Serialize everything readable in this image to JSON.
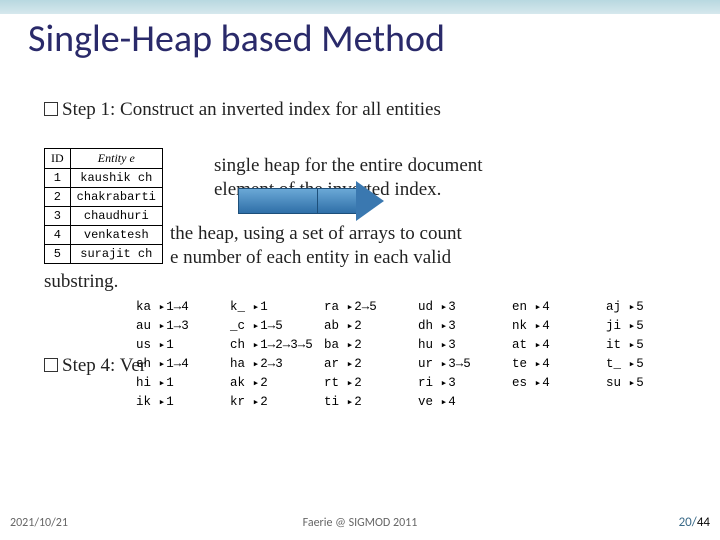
{
  "title": "Single-Heap based Method",
  "steps": {
    "s1": "Step 1: Construct an inverted index for all entities",
    "s2_a": "single heap for the entire document",
    "s2_b": "element of the inverted index.",
    "s3_a": "the heap, using a set of arrays to count",
    "s3_b": "e number of each entity in each valid",
    "s3_c": "substring.",
    "s4": "Step 4: Ver"
  },
  "entity_table": {
    "headers": {
      "id": "ID",
      "entity": "Entity e"
    },
    "rows": [
      {
        "id": "1",
        "entity": "kaushik ch"
      },
      {
        "id": "2",
        "entity": "chakrabarti"
      },
      {
        "id": "3",
        "entity": "chaudhuri"
      },
      {
        "id": "4",
        "entity": "venkatesh"
      },
      {
        "id": "5",
        "entity": "surajit ch"
      }
    ]
  },
  "inverted_index": [
    [
      {
        "tok": "ka",
        "list": "1→4"
      },
      {
        "tok": "k_",
        "list": "1"
      },
      {
        "tok": "ra",
        "list": "2→5"
      },
      {
        "tok": "ud",
        "list": "3"
      },
      {
        "tok": "en",
        "list": "4"
      },
      {
        "tok": "aj",
        "list": "5"
      }
    ],
    [
      {
        "tok": "au",
        "list": "1→3"
      },
      {
        "tok": "_c",
        "list": "1→5"
      },
      {
        "tok": "ab",
        "list": "2"
      },
      {
        "tok": "dh",
        "list": "3"
      },
      {
        "tok": "nk",
        "list": "4"
      },
      {
        "tok": "ji",
        "list": "5"
      }
    ],
    [
      {
        "tok": "us",
        "list": "1"
      },
      {
        "tok": "ch",
        "list": "1→2→3→5"
      },
      {
        "tok": "ba",
        "list": "2"
      },
      {
        "tok": "hu",
        "list": "3"
      },
      {
        "tok": "at",
        "list": "4"
      },
      {
        "tok": "it",
        "list": "5"
      }
    ],
    [
      {
        "tok": "sh",
        "list": "1→4"
      },
      {
        "tok": "ha",
        "list": "2→3"
      },
      {
        "tok": "ar",
        "list": "2"
      },
      {
        "tok": "ur",
        "list": "3→5"
      },
      {
        "tok": "te",
        "list": "4"
      },
      {
        "tok": "t_",
        "list": "5"
      }
    ],
    [
      {
        "tok": "hi",
        "list": "1"
      },
      {
        "tok": "ak",
        "list": "2"
      },
      {
        "tok": "rt",
        "list": "2"
      },
      {
        "tok": "ri",
        "list": "3"
      },
      {
        "tok": "es",
        "list": "4"
      },
      {
        "tok": "su",
        "list": "5"
      }
    ],
    [
      {
        "tok": "ik",
        "list": "1"
      },
      {
        "tok": "kr",
        "list": "2"
      },
      {
        "tok": "ti",
        "list": "2"
      },
      {
        "tok": "ve",
        "list": "4"
      },
      {
        "tok": "",
        "list": ""
      },
      {
        "tok": "",
        "list": ""
      }
    ]
  ],
  "footer": {
    "date": "2021/10/21",
    "center": "Faerie @ SIGMOD 2011",
    "page_current": "20",
    "page_total": "44"
  }
}
